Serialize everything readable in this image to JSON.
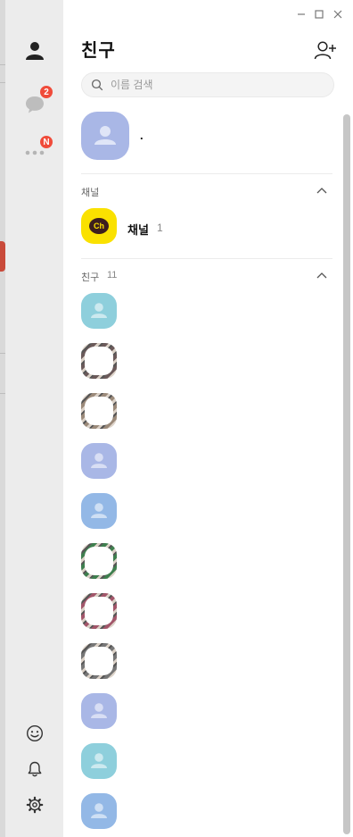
{
  "window": {
    "minimize_icon": "minimize-icon",
    "maximize_icon": "maximize-icon",
    "close_icon": "close-icon"
  },
  "sidebar": {
    "items": [
      {
        "name": "friends",
        "icon": "person-icon"
      },
      {
        "name": "chats",
        "icon": "chat-bubble-icon",
        "badge": "2"
      },
      {
        "name": "more",
        "icon": "more-dots-icon",
        "badge": "N"
      }
    ],
    "bottom": [
      {
        "name": "emoticon",
        "icon": "smiley-icon"
      },
      {
        "name": "notifications",
        "icon": "bell-icon"
      },
      {
        "name": "settings",
        "icon": "gear-icon"
      }
    ]
  },
  "header": {
    "title": "친구",
    "add_friend_icon": "add-friend-icon"
  },
  "search": {
    "placeholder": "이름 검색"
  },
  "profile": {
    "name": "."
  },
  "channel_section": {
    "label": "채널",
    "item": {
      "name": "채널",
      "count": "1",
      "logo_text": "Ch"
    }
  },
  "friends_section": {
    "label": "친구",
    "count": "11",
    "friends": [
      {
        "avatar": "default",
        "color": "#8ecfdc"
      },
      {
        "avatar": "photo",
        "color": "#6b5a5a"
      },
      {
        "avatar": "photo",
        "color": "#9b8a7a"
      },
      {
        "avatar": "default",
        "color": "#a9b7e6"
      },
      {
        "avatar": "default",
        "color": "#93b8e6"
      },
      {
        "avatar": "photo",
        "color": "#3f7f4f"
      },
      {
        "avatar": "photo",
        "color": "#a2566a"
      },
      {
        "avatar": "photo",
        "color": "#777777"
      },
      {
        "avatar": "default",
        "color": "#a9b7e6"
      },
      {
        "avatar": "default",
        "color": "#8ecfdc"
      },
      {
        "avatar": "default",
        "color": "#93b8e6"
      }
    ]
  },
  "colors": {
    "badge": "#f04b3a",
    "channel_logo": "#fae100",
    "sidebar_bg": "#ececec"
  }
}
